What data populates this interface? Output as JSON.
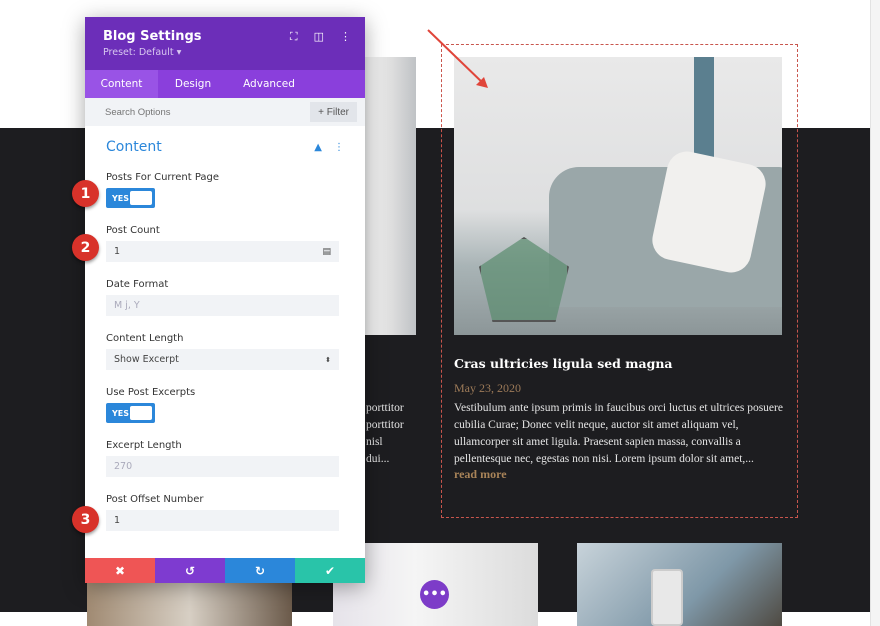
{
  "panel": {
    "title": "Blog Settings",
    "preset": "Preset: Default ▾",
    "tabs": [
      {
        "label": "Content"
      },
      {
        "label": "Design"
      },
      {
        "label": "Advanced"
      }
    ],
    "search_placeholder": "Search Options",
    "filter_label": "+ Filter",
    "section_title": "Content",
    "fields": {
      "posts_current_label": "Posts For Current Page",
      "posts_current_value": "YES",
      "post_count_label": "Post Count",
      "post_count_value": "1",
      "date_format_label": "Date Format",
      "date_format_placeholder": "M j, Y",
      "content_length_label": "Content Length",
      "content_length_value": "Show Excerpt",
      "use_excerpts_label": "Use Post Excerpts",
      "use_excerpts_value": "YES",
      "excerpt_length_label": "Excerpt Length",
      "excerpt_length_placeholder": "270",
      "offset_label": "Post Offset Number",
      "offset_value": "1"
    },
    "footer": {
      "cancel": "✖",
      "undo": "↺",
      "redo": "↻",
      "save": "✔"
    },
    "colors": {
      "header": "#6c2eb9",
      "tabs": "#8a3fdc",
      "accent": "#2b87da",
      "cancel": "#ef5555",
      "undo": "#7e3bd0",
      "redo": "#2b87da",
      "save": "#29c4a9"
    }
  },
  "badges": [
    "1",
    "2",
    "3"
  ],
  "post": {
    "title": "Cras ultricies ligula sed magna",
    "date": "May 23, 2020",
    "excerpt": "Vestibulum ante ipsum primis in faucibus orci luctus et ultrices posuere cubilia Curae; Donec velit neque, auctor sit amet aliquam vel, ullamcorper sit amet ligula. Praesent sapien massa, convallis a pellentesque nec, egestas non nisi. Lorem ipsum dolor sit amet,...",
    "read_more": "read more"
  },
  "left_post_fragment": [
    "porttitor",
    "porttitor",
    "nisl",
    "dui..."
  ],
  "more_button": "•••"
}
